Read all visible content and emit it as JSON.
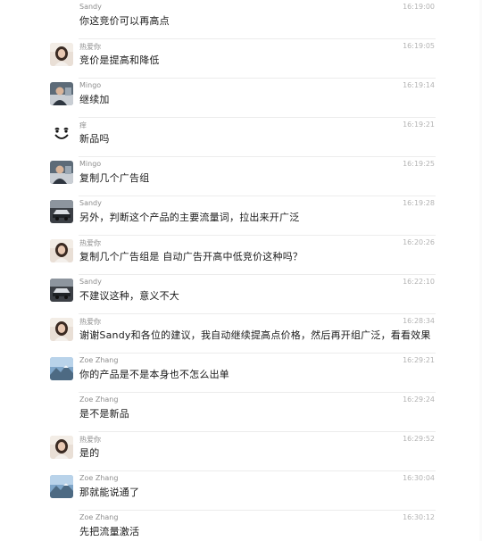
{
  "messages": [
    {
      "sender": "Sandy",
      "time": "16:19:00",
      "text": "你这竞价可以再高点",
      "avatar": "none"
    },
    {
      "sender": "热爱你",
      "time": "16:19:05",
      "text": "竞价是提高和降低",
      "avatar": "woman-photo-avatar"
    },
    {
      "sender": "Mingo",
      "time": "16:19:14",
      "text": "继续加",
      "avatar": "man-photo-avatar"
    },
    {
      "sender": "痒",
      "time": "16:19:21",
      "text": "新品吗",
      "avatar": "smiley-face-avatar"
    },
    {
      "sender": "Mingo",
      "time": "16:19:25",
      "text": "复制几个广告组",
      "avatar": "man-photo-avatar"
    },
    {
      "sender": "Sandy",
      "time": "16:19:28",
      "text": "另外，判断这个产品的主要流量词，拉出来开广泛",
      "avatar": "car-photo-avatar"
    },
    {
      "sender": "热爱你",
      "time": "16:20:26",
      "text": "复制几个广告组是 自动广告开高中低竞价这种吗？",
      "avatar": "woman-photo-avatar"
    },
    {
      "sender": "Sandy",
      "time": "16:22:10",
      "text": "不建议这种，意义不大",
      "avatar": "car-photo-avatar"
    },
    {
      "sender": "热爱你",
      "time": "16:28:34",
      "text": "谢谢Sandy和各位的建议，我自动继续提高点价格，然后再开组广泛，看看效果",
      "avatar": "woman-photo-avatar"
    },
    {
      "sender": "Zoe Zhang",
      "time": "16:29:21",
      "text": "你的产品是不是本身也不怎么出单",
      "avatar": "mountain-photo-avatar"
    },
    {
      "sender": "Zoe Zhang",
      "time": "16:29:24",
      "text": "是不是新品",
      "avatar": "none"
    },
    {
      "sender": "热爱你",
      "time": "16:29:52",
      "text": "是的",
      "avatar": "woman-photo-avatar"
    },
    {
      "sender": "Zoe Zhang",
      "time": "16:30:04",
      "text": "那就能说通了",
      "avatar": "mountain-photo-avatar"
    },
    {
      "sender": "Zoe Zhang",
      "time": "16:30:12",
      "text": "先把流量激活",
      "avatar": "none"
    }
  ]
}
